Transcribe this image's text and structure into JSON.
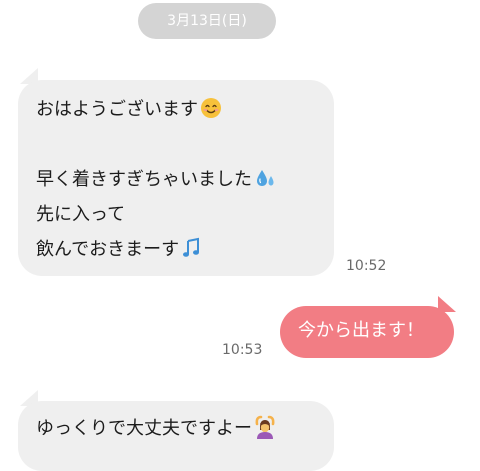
{
  "chat": {
    "date_label": "3月13日(日)",
    "messages": [
      {
        "sender": "other",
        "lines": [
          "おはようございます",
          "",
          "早く着きすぎちゃいました",
          "先に入って",
          "飲んでおきまーす"
        ],
        "time": "10:52"
      },
      {
        "sender": "self",
        "lines": [
          "今から出ます！"
        ],
        "time": "10:53"
      },
      {
        "sender": "other",
        "lines": [
          "ゆっくりで大丈夫ですよー"
        ]
      }
    ]
  },
  "icons": {
    "smile": "smiling-face-emoji",
    "sweat_drops": "sweat-droplets-emoji",
    "music_notes": "musical-notes-emoji",
    "ok_person": "person-gesturing-ok-emoji"
  },
  "colors": {
    "incoming_bubble": "#efefef",
    "outgoing_bubble": "#f27d84",
    "date_pill": "#d4d4d4"
  }
}
